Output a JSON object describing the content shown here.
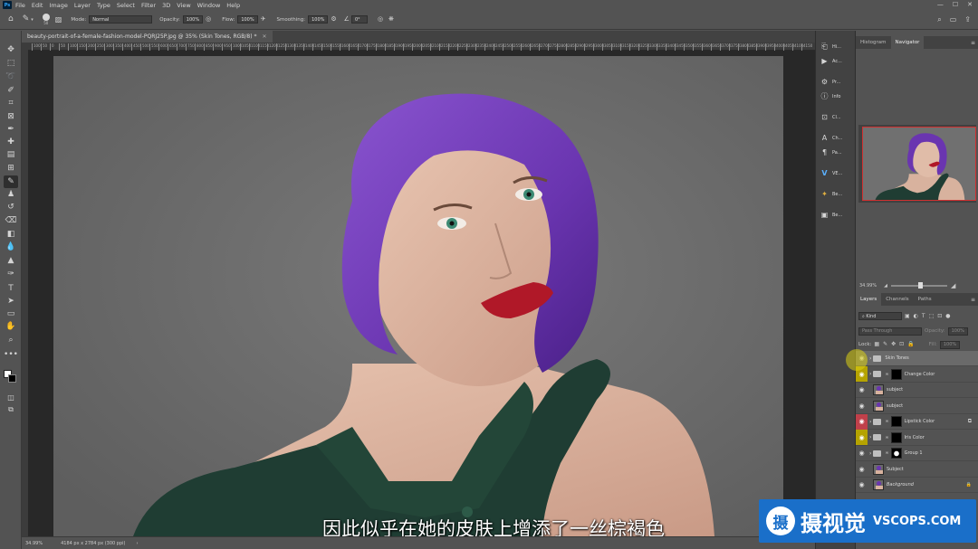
{
  "menu": [
    "File",
    "Edit",
    "Image",
    "Layer",
    "Type",
    "Select",
    "Filter",
    "3D",
    "View",
    "Window",
    "Help"
  ],
  "app_badge": "Ps",
  "options": {
    "brush_size": "50",
    "mode_label": "Mode:",
    "mode_value": "Normal",
    "opacity_label": "Opacity:",
    "opacity_value": "100%",
    "flow_label": "Flow:",
    "flow_value": "100%",
    "smoothing_label": "Smoothing:",
    "smoothing_value": "100%",
    "angle_value": "0°"
  },
  "document_tab": "beauty-portrait-of-a-female-fashion-model-PQRJ25P.jpg @ 35% (Skin Tones, RGB/8) *",
  "ruler_ticks": [
    "100",
    "50",
    "0",
    "50",
    "100",
    "150",
    "200",
    "250",
    "300",
    "350",
    "400",
    "450",
    "500",
    "550",
    "600",
    "650",
    "700",
    "750",
    "800",
    "850",
    "900",
    "950",
    "1000",
    "1050",
    "1100",
    "1150",
    "1200",
    "1250",
    "1300",
    "1350",
    "1400",
    "1450",
    "1500",
    "1550",
    "1600",
    "1650",
    "1700",
    "1750",
    "1800",
    "1850",
    "1900",
    "1950",
    "2000",
    "2050",
    "2100",
    "2150",
    "2200",
    "2250",
    "2300",
    "2350",
    "2400",
    "2450",
    "2500",
    "2550",
    "2600",
    "2650",
    "2700",
    "2750",
    "2800",
    "2850",
    "2900",
    "2950",
    "3000",
    "3050",
    "3100",
    "3150",
    "3200",
    "3250",
    "3300",
    "3350",
    "3400",
    "3450",
    "3500",
    "3550",
    "3600",
    "3650",
    "3700",
    "3750",
    "3800",
    "3850",
    "3900",
    "3950",
    "4000",
    "4050",
    "4100",
    "4150"
  ],
  "status": {
    "zoom": "34.99%",
    "doc_size": "4184 px x 2784 px (300 ppi)"
  },
  "subtitle": "因此似乎在她的皮肤上增添了一丝棕褐色",
  "dock_items": [
    "Hi...",
    "Ac...",
    "Pr...",
    "Info",
    "Cl...",
    "Ch...",
    "Pa...",
    "VE...",
    "Be...",
    "Be..."
  ],
  "panels": {
    "top_tabs": [
      "Histogram",
      "Navigator"
    ],
    "navigator_zoom": "34.99%",
    "layer_tabs": [
      "Layers",
      "Channels",
      "Paths"
    ],
    "filter_kind": "Kind",
    "blend_mode": "Pass Through",
    "opacity_label": "Opacity:",
    "opacity_value": "100%",
    "lock_label": "Lock:",
    "fill_label": "Fill:",
    "fill_value": "100%"
  },
  "layers": [
    {
      "name": "Skin Tones",
      "kind": "group",
      "selected": true,
      "eye_color": ""
    },
    {
      "name": "Change Color",
      "kind": "group-mask",
      "selected": false,
      "eye_color": "#b5a300"
    },
    {
      "name": "subject",
      "kind": "photo",
      "selected": false,
      "eye_color": ""
    },
    {
      "name": "subject",
      "kind": "photo",
      "selected": false,
      "eye_color": ""
    },
    {
      "name": "Lipstick Color",
      "kind": "group-mask",
      "selected": false,
      "eye_color": "#c0404a"
    },
    {
      "name": "Iris Color",
      "kind": "group-mask",
      "selected": false,
      "eye_color": "#b5a300"
    },
    {
      "name": "Group 1",
      "kind": "group-mask-white",
      "selected": false,
      "eye_color": ""
    },
    {
      "name": "Subject",
      "kind": "photo",
      "selected": false,
      "eye_color": ""
    },
    {
      "name": "Background",
      "kind": "photo-locked",
      "selected": false,
      "eye_color": ""
    }
  ],
  "watermark": {
    "glyph": "摄",
    "cn": "摄视觉",
    "en": "VSCOPS.COM"
  },
  "colors": {
    "app_bg": "#535353",
    "canvas_bg": "#6c6c6c",
    "hair": "#6a35b0",
    "shirt": "#1f3d33",
    "lips": "#b01828",
    "watermark_bg": "#1a6fc9"
  }
}
